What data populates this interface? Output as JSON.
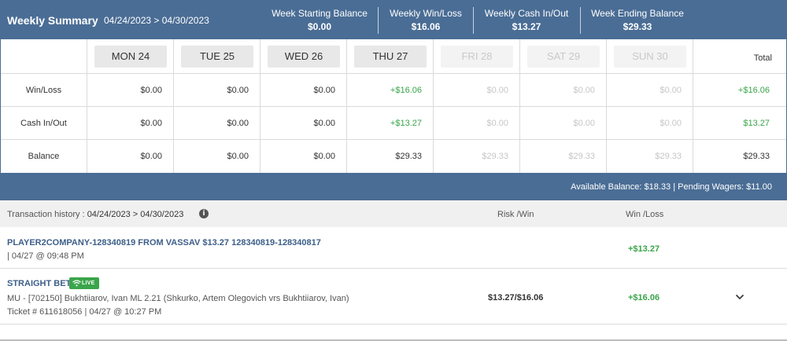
{
  "header": {
    "title": "Weekly Summary",
    "range": "04/24/2023 > 04/30/2023",
    "stats": [
      {
        "label": "Week Starting Balance",
        "value": "$0.00"
      },
      {
        "label": "Weekly Win/Loss",
        "value": "$16.06"
      },
      {
        "label": "Weekly Cash In/Out",
        "value": "$13.27"
      },
      {
        "label": "Week Ending Balance",
        "value": "$29.33"
      }
    ]
  },
  "grid": {
    "days": [
      "MON 24",
      "TUE 25",
      "WED 26",
      "THU 27",
      "FRI 28",
      "SAT 29",
      "SUN 30"
    ],
    "total_label": "Total",
    "rows": [
      {
        "label": "Win/Loss",
        "values": [
          "$0.00",
          "$0.00",
          "$0.00",
          "+$16.06",
          "$0.00",
          "$0.00",
          "$0.00"
        ],
        "total": "+$16.06"
      },
      {
        "label": "Cash In/Out",
        "values": [
          "$0.00",
          "$0.00",
          "$0.00",
          "+$13.27",
          "$0.00",
          "$0.00",
          "$0.00"
        ],
        "total": "$13.27"
      },
      {
        "label": "Balance",
        "values": [
          "$0.00",
          "$0.00",
          "$0.00",
          "$29.33",
          "$29.33",
          "$29.33",
          "$29.33"
        ],
        "total": "$29.33"
      }
    ]
  },
  "balance_bar": {
    "text": "Available Balance: $18.33 | Pending Wagers: $11.00"
  },
  "transactions": {
    "history_label": "Transaction history : ",
    "history_range": "04/24/2023 > 04/30/2023",
    "info_icon": "info-icon",
    "col_risk_win": "Risk /Win",
    "col_win_loss": "Win /Loss",
    "items": [
      {
        "name": "PLAYER2COMPANY-128340819 FROM VASSAV $13.27 128340819-128340817",
        "date": "| 04/27 @ 09:48 PM",
        "win_loss": "+$13.27"
      },
      {
        "name": "STRAIGHT BET",
        "badge": "LIVE",
        "detail": "MU - [702150] Bukhtiiarov, Ivan ML 2.21 (Shkurko, Artem Olegovich vrs Bukhtiiarov, Ivan)",
        "ticket": "Ticket # 611618056 | 04/27 @ 10:27 PM",
        "risk_win": "$13.27/$16.06",
        "win_loss": "+$16.06"
      }
    ]
  },
  "colors": {
    "header_bg": "#4a6d95",
    "positive": "#3aa54a",
    "link": "#3c5e89"
  }
}
